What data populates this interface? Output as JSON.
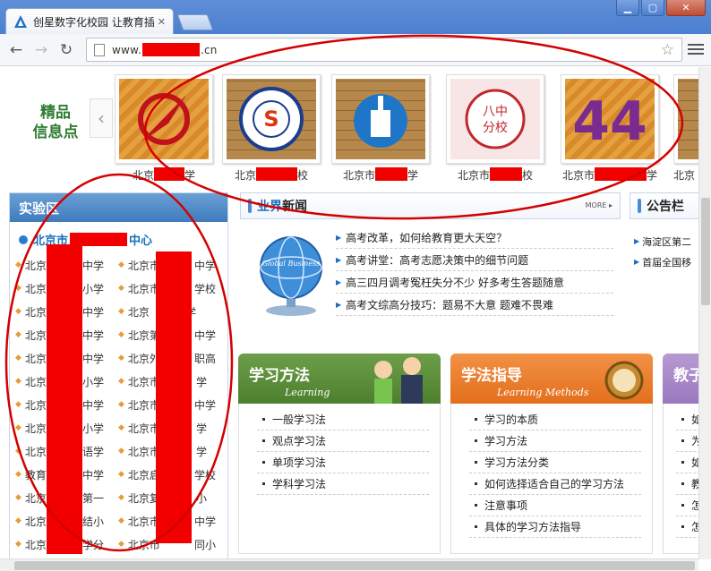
{
  "browser": {
    "tab_title": "创星数字化校园 让教育插",
    "url_prefix": "www.",
    "url_suffix": ".cn"
  },
  "featured": {
    "label_line1": "精品",
    "label_line2": "信息点",
    "schools": [
      {
        "prefix": "北京",
        "suffix": "学",
        "logo": "red-arrow-logo"
      },
      {
        "prefix": "北京",
        "suffix": "校",
        "logo": "school-emblem-logo"
      },
      {
        "prefix": "北京市",
        "suffix": "学",
        "logo": "blue-building-logo"
      },
      {
        "prefix": "北京市",
        "suffix": "校",
        "logo": "eighth-school-branch-logo"
      },
      {
        "prefix": "北京市",
        "suffix": "学",
        "logo": "number-44-logo"
      },
      {
        "prefix": "北京",
        "suffix": "",
        "logo": "partial-logo"
      }
    ]
  },
  "lab": {
    "title": "实验区",
    "center_prefix": "北京市",
    "center_suffix": "中心",
    "rows": [
      [
        "北京",
        "中学",
        "北京市",
        "中学"
      ],
      [
        "北京",
        "小学",
        "北京市",
        "学校"
      ],
      [
        "北京",
        "中学",
        "北京",
        "学"
      ],
      [
        "北京",
        "中学",
        "北京第",
        "中学"
      ],
      [
        "北京",
        "中学",
        "北京外",
        "职高"
      ],
      [
        "北京",
        "小学",
        "北京市",
        "学"
      ],
      [
        "北京",
        "中学",
        "北京市",
        "中学"
      ],
      [
        "北京",
        "小学",
        "北京市",
        "学"
      ],
      [
        "北京",
        "语学",
        "北京市",
        "学"
      ],
      [
        "教育",
        "中学",
        "北京启",
        "学校"
      ],
      [
        "北京",
        "第一",
        "北京复",
        "小"
      ],
      [
        "北京",
        "结小",
        "北京市",
        "中学"
      ],
      [
        "北京",
        "学分",
        "北京市",
        "同小"
      ]
    ]
  },
  "news": {
    "title_blue": "业界",
    "title_black": "新闻",
    "more": "MORE",
    "globe_text": "Global Business",
    "items": [
      "高考改革，如何给教育更大天空？",
      "高考讲堂：高考志愿决策中的细节问题",
      "高三四月调考冤枉失分不少 好多考生答题随意",
      "高考文综高分技巧：题易不大意 题难不畏难"
    ]
  },
  "notice": {
    "title": "公告栏",
    "items": [
      "海淀区第二",
      "首届全国移"
    ]
  },
  "methods": [
    {
      "title": "学习方法",
      "subtitle": "Learning",
      "items": [
        "一般学习法",
        "观点学习法",
        "单项学习法",
        "学科学习法"
      ]
    },
    {
      "title": "学法指导",
      "subtitle": "Learning Methods",
      "items": [
        "学习的本质",
        "学习方法",
        "学习方法分类",
        "如何选择适合自己的学习方法",
        "注意事项",
        "具体的学习方法指导"
      ]
    },
    {
      "title": "教子",
      "subtitle": "",
      "items": [
        "如",
        "为",
        "如",
        "教",
        "怎",
        "怎"
      ]
    }
  ],
  "colors": {
    "redaction": "#f20000",
    "link_blue": "#1a6fc1",
    "annotation_red": "#d40000"
  }
}
